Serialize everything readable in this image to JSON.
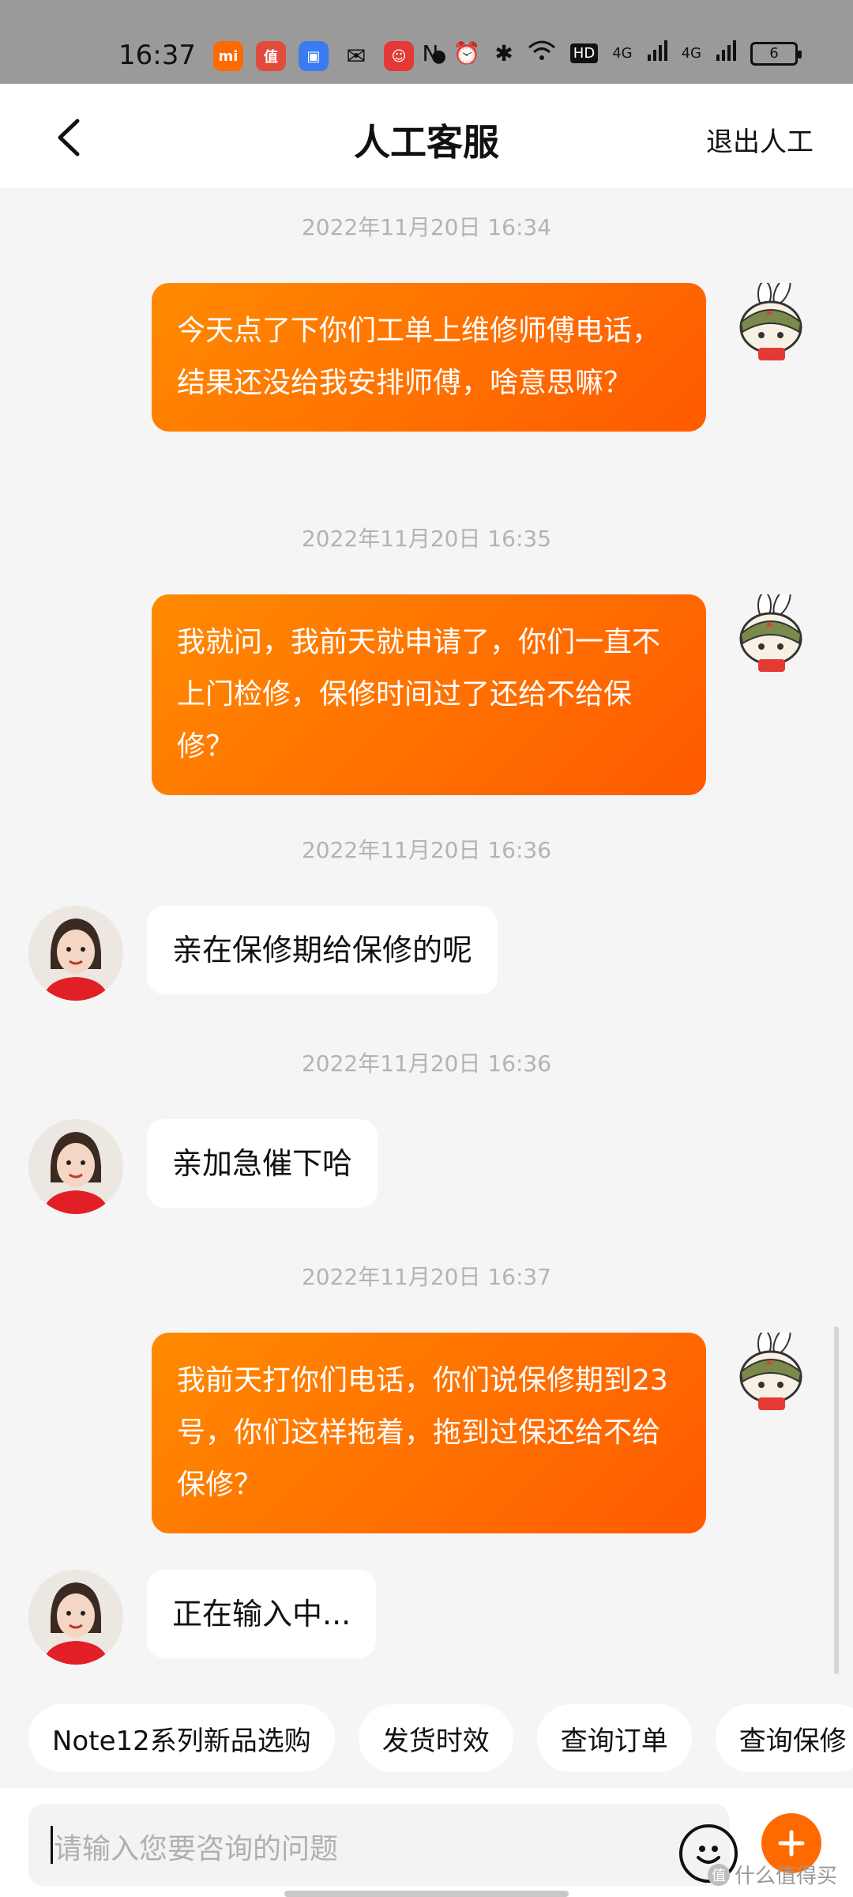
{
  "status_bar": {
    "time": "16:37",
    "left_icons": [
      "xiaomi-app-icon",
      "smzdm-app-icon",
      "multitask-app-icon",
      "wechat-icon",
      "mi-bunny-app-icon"
    ],
    "right_labels": {
      "hd": "HD",
      "net1": "4G",
      "net2": "4G",
      "battery": "6"
    }
  },
  "header": {
    "title": "人工客服",
    "exit_label": "退出人工"
  },
  "messages": {
    "m1": {
      "time": "2022年11月20日 16:34",
      "text": "今天点了下你们工单上维修师傅电话，结果还没给我安排师傅，啥意思嘛？"
    },
    "m2": {
      "time": "2022年11月20日 16:35",
      "text": "我就问，我前天就申请了，你们一直不上门检修，保修时间过了还给不给保修？"
    },
    "m3": {
      "time": "2022年11月20日 16:36",
      "text": "亲在保修期给保修的呢"
    },
    "m4": {
      "time": "2022年11月20日 16:36",
      "text": "亲加急催下哈"
    },
    "m5": {
      "time": "2022年11月20日 16:37",
      "text": "我前天打你们电话，你们说保修期到23号，你们这样拖着，拖到过保还给不给保修？"
    },
    "m6": {
      "text": "正在输入中..."
    }
  },
  "quick_replies": [
    "Note12系列新品选购",
    "发货时效",
    "查询订单",
    "查询保修"
  ],
  "input": {
    "placeholder": "请输入您要咨询的问题"
  },
  "watermark": {
    "text": "什么值得买",
    "badge": "值"
  },
  "colors": {
    "accent": "#ff6a00",
    "bubble_out_start": "#ff8a00",
    "bubble_out_end": "#ff5a00"
  }
}
